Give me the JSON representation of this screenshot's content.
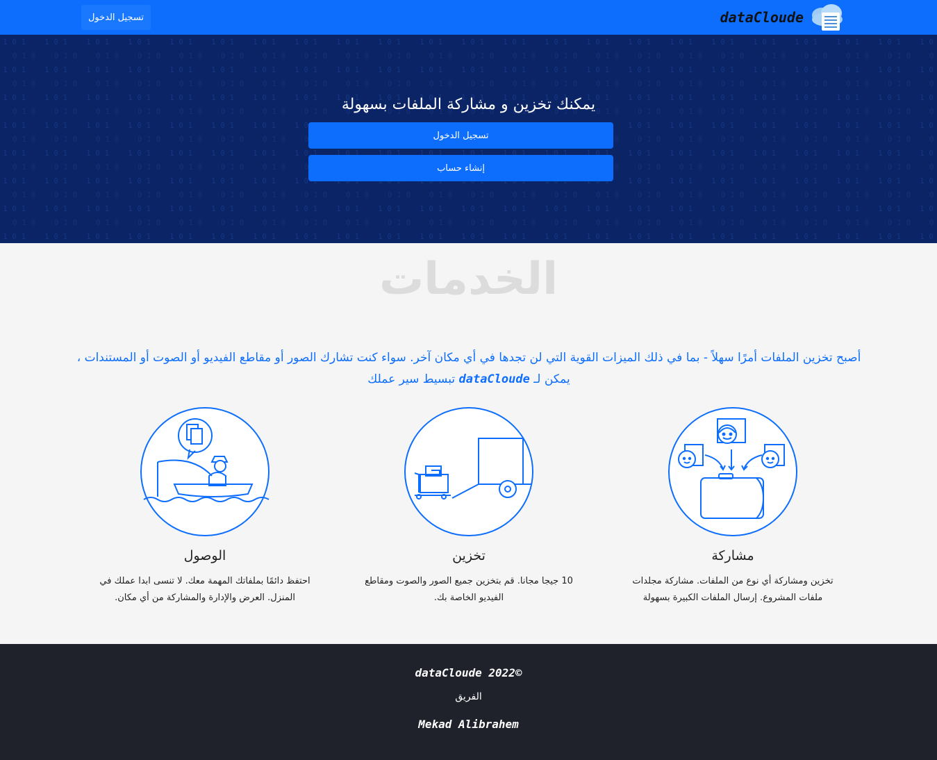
{
  "navbar": {
    "login_label": "تسجيل الدخول",
    "brand": "dataCloude",
    "logo_icon": "cloud-document-icon",
    "background": "#0d6efd"
  },
  "hero": {
    "title": "يمكنك تخزين و مشاركة الملفات بسهولة",
    "login_label": "تسجيل الدخول",
    "signup_label": "إنشاء حساب",
    "background": "#0b2466"
  },
  "services": {
    "heading": "الخدمات",
    "intro_text": "أصبح تخزين الملفات أمرًا سهلاً - بما في ذلك الميزات القوية التي لن تجدها في أي مكان آخر. سواء كنت تشارك الصور أو مقاطع الفيديو أو الصوت أو المستندات ، يمكن لـ",
    "intro_brand": "dataCloude",
    "intro_end": "تبسيط سير عملك",
    "items": [
      {
        "icon": "people-sharing-files-icon",
        "title": "مشاركة",
        "text": "تخزين ومشاركة أي نوع من الملفات. مشاركة مجلدات ملفات المشروع. إرسال الملفات الكبيرة بسهولة"
      },
      {
        "icon": "truck-storage-icon",
        "title": "تخزين",
        "text": "10 جيجا مجانا. قم بتخزين جميع الصور والصوت ومقاطع الفيديو الخاصة بك."
      },
      {
        "icon": "fisherman-boat-icon",
        "title": "الوصول",
        "text": "احتفظ دائمًا بملفاتك المهمة معك. لا تنسى ابدا عملك في المنزل. العرض والإدارة والمشاركة من أي مكان."
      }
    ],
    "accent": "#0d6efd"
  },
  "footer": {
    "copyright": "dataCloude 2022©",
    "team_label": "الفريق",
    "member": "Mekad Alibrahem",
    "background": "#1f222b"
  }
}
